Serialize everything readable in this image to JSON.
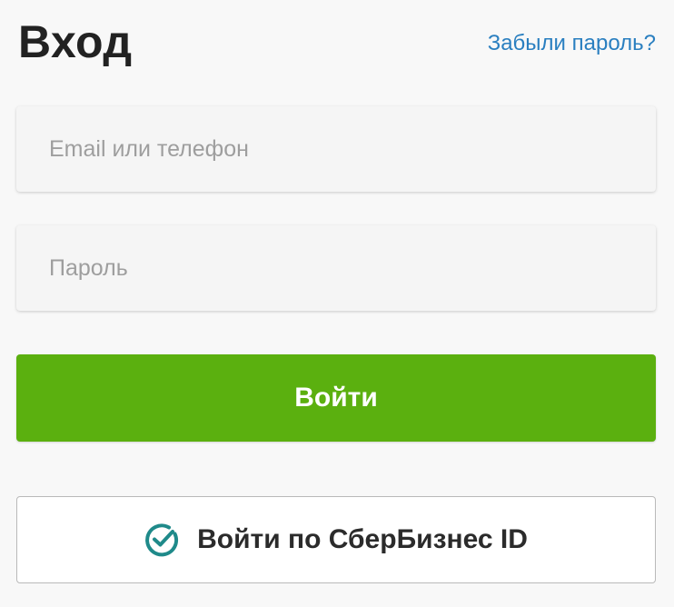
{
  "header": {
    "title": "Вход",
    "forgot_password": "Забыли пароль?"
  },
  "form": {
    "email_placeholder": "Email или телефон",
    "email_value": "",
    "password_placeholder": "Пароль",
    "password_value": "",
    "login_button": "Войти",
    "sber_button": "Войти по СберБизнес ID",
    "sber_icon": "sber-check-circle-icon"
  },
  "colors": {
    "accent_green": "#5bb00f",
    "link_blue": "#2a7fc0",
    "sber_teal": "#1f8a8a"
  }
}
